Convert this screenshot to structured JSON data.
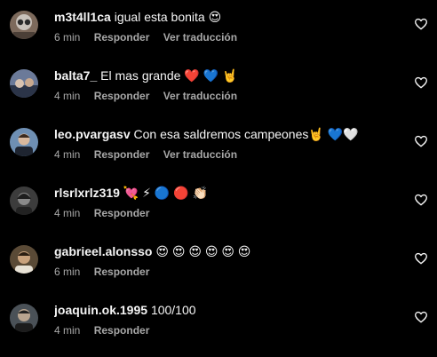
{
  "colors": {
    "background": "#000000",
    "text_primary": "#f5f5f5",
    "text_secondary": "#a8a8a8"
  },
  "comments": [
    {
      "username": "m3t4ll1ca",
      "text": "igual esta bonita 😍",
      "time": "6 min",
      "reply_label": "Responder",
      "translate_label": "Ver traducción",
      "like_icon": "heart-outline-icon"
    },
    {
      "username": "balta7_",
      "text": "El mas grande ❤️ 💙 🤘",
      "time": "4 min",
      "reply_label": "Responder",
      "translate_label": "Ver traducción",
      "like_icon": "heart-outline-icon"
    },
    {
      "username": "leo.pvargasv",
      "text": "Con esa saldremos campeones🤘 💙🤍",
      "time": "4 min",
      "reply_label": "Responder",
      "translate_label": "Ver traducción",
      "like_icon": "heart-outline-icon"
    },
    {
      "username": "rlsrlxrlz319",
      "text": "💘 ⚡ 🔵 🔴 👏🏻",
      "time": "4 min",
      "reply_label": "Responder",
      "like_icon": "heart-outline-icon"
    },
    {
      "username": "gabrieel.alonsso",
      "text": "😍 😍 😍 😍 😍 😍",
      "time": "6 min",
      "reply_label": "Responder",
      "like_icon": "heart-outline-icon"
    },
    {
      "username": "joaquin.ok.1995",
      "text": "100/100",
      "time": "4 min",
      "reply_label": "Responder",
      "like_icon": "heart-outline-icon"
    }
  ]
}
